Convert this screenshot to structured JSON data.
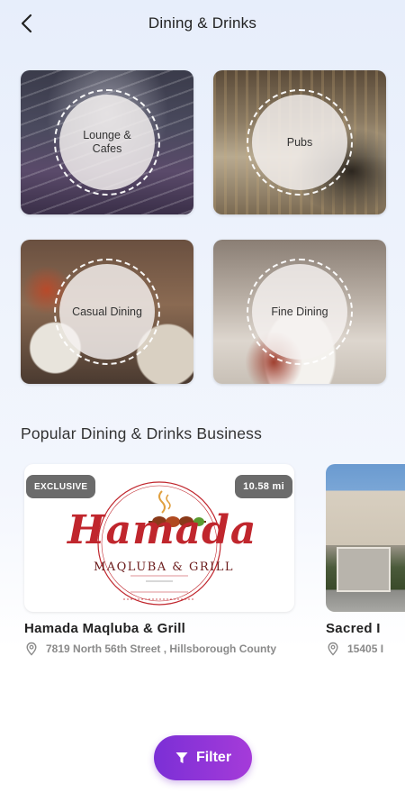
{
  "header": {
    "title": "Dining & Drinks",
    "back_icon": "chevron-left-icon"
  },
  "categories": [
    {
      "label": "Lounge &\nCafes",
      "label_line1": "Lounge &",
      "label_line2": "Cafes"
    },
    {
      "label": "Pubs"
    },
    {
      "label": "Casual Dining"
    },
    {
      "label": "Fine Dining"
    }
  ],
  "section": {
    "title": "Popular Dining & Drinks Business"
  },
  "businesses": [
    {
      "badge": "EXCLUSIVE",
      "distance": "10.58 mi",
      "logo_text_main": "Hamada",
      "logo_text_sub": "MAQLUBA & GRILL",
      "name": "Hamada Maqluba & Grill",
      "address": "7819 North 56th Street , Hillsborough County"
    },
    {
      "name": "Sacred I",
      "address": "15405 I"
    }
  ],
  "filter": {
    "label": "Filter",
    "icon": "filter-funnel-icon"
  },
  "colors": {
    "accent_start": "#7b2fd6",
    "accent_end": "#a53bd9",
    "badge_bg": "#6b6b6b",
    "logo_red": "#c0262d"
  }
}
